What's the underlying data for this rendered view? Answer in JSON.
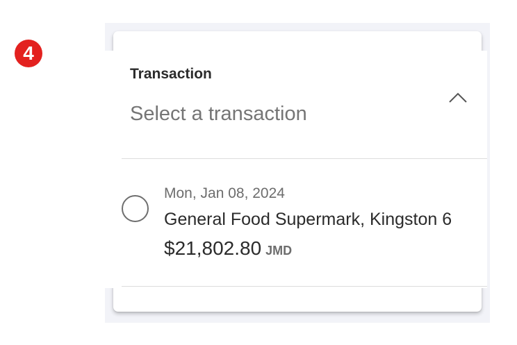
{
  "step": {
    "number": "4",
    "color": "#e3211f"
  },
  "transaction_field": {
    "label": "Transaction",
    "placeholder": "Select a transaction",
    "expand_icon": "chevron-up-icon",
    "expanded": true
  },
  "transactions": [
    {
      "date": "Mon, Jan 08, 2024",
      "merchant": "General Food Supermark, Kingston 6",
      "amount": "$21,802.80",
      "currency": "JMD",
      "selected": false
    }
  ]
}
